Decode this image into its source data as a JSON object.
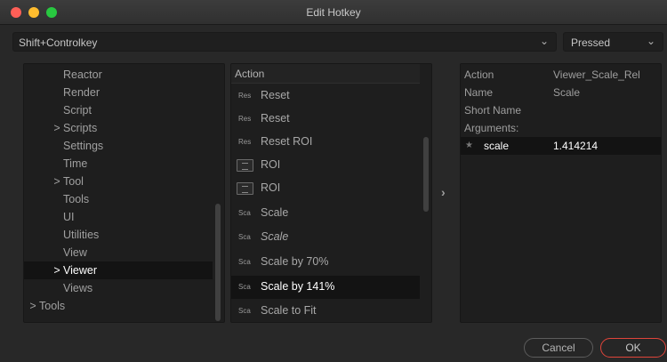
{
  "window": {
    "title": "Edit Hotkey"
  },
  "hotkey": {
    "value": "Shift+Controlkey"
  },
  "mode": {
    "selected": "Pressed"
  },
  "tree": {
    "items": [
      {
        "label": "Reactor",
        "expander": ""
      },
      {
        "label": "Render",
        "expander": ""
      },
      {
        "label": "Script",
        "expander": ""
      },
      {
        "label": "Scripts",
        "expander": ">"
      },
      {
        "label": "Settings",
        "expander": ""
      },
      {
        "label": "Time",
        "expander": ""
      },
      {
        "label": "Tool",
        "expander": ">"
      },
      {
        "label": "Tools",
        "expander": ""
      },
      {
        "label": "UI",
        "expander": ""
      },
      {
        "label": "Utilities",
        "expander": ""
      },
      {
        "label": "View",
        "expander": ""
      },
      {
        "label": "Viewer",
        "expander": ">"
      },
      {
        "label": "Views",
        "expander": ""
      },
      {
        "label": "Tools",
        "expander": ">"
      }
    ]
  },
  "actions": {
    "header": "Action",
    "rows": [
      {
        "prefix": "Res",
        "label": "Reset"
      },
      {
        "prefix": "Res",
        "label": "Reset"
      },
      {
        "prefix": "Res",
        "label": "Reset ROI"
      },
      {
        "prefix": "",
        "label": "ROI",
        "icon": "roi-icon"
      },
      {
        "prefix": "",
        "label": "ROI",
        "icon": "roi-icon"
      },
      {
        "prefix": "Sca",
        "label": "Scale"
      },
      {
        "prefix": "Sca",
        "label": "Scale"
      },
      {
        "prefix": "Sca",
        "label": "Scale by 70%"
      },
      {
        "prefix": "Sca",
        "label": "Scale by 141%"
      },
      {
        "prefix": "Sca",
        "label": "Scale to Fit"
      }
    ]
  },
  "transfer": {
    "glyph": "›"
  },
  "details": {
    "action_key": "Action",
    "action_val": "Viewer_Scale_Rel",
    "name_key": "Name",
    "name_val": "Scale",
    "short_key": "Short Name",
    "short_val": "",
    "args_key": "Arguments:",
    "arg_name": "scale",
    "arg_val": "1.414214"
  },
  "buttons": {
    "cancel": "Cancel",
    "ok": "OK"
  },
  "icons": {
    "chevron": "⌄",
    "star": "★"
  },
  "colors": {
    "accent": "#e0443a",
    "selection": "#131313"
  }
}
